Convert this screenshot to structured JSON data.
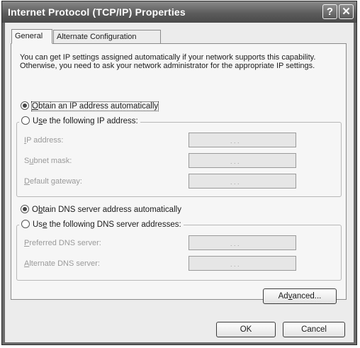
{
  "window": {
    "title": "Internet Protocol (TCP/IP) Properties",
    "help_glyph": "?",
    "close_glyph": "✕"
  },
  "tabs": [
    {
      "label": "General"
    },
    {
      "label": "Alternate Configuration"
    }
  ],
  "general": {
    "description": "You can get IP settings assigned automatically if your network supports this capability. Otherwise, you need to ask your network administrator for the appropriate IP settings.",
    "ip_auto": {
      "pre": "",
      "key": "O",
      "post": "btain an IP address automatically",
      "selected": true
    },
    "ip_manual": {
      "pre": "U",
      "key": "s",
      "post": "e the following IP address:",
      "selected": false
    },
    "ip_fields": [
      {
        "pre": "",
        "key": "I",
        "post": "P address:",
        "value": ".   .   ."
      },
      {
        "pre": "S",
        "key": "u",
        "post": "bnet mask:",
        "value": ".   .   ."
      },
      {
        "pre": "",
        "key": "D",
        "post": "efault gateway:",
        "value": ".   .   ."
      }
    ],
    "dns_auto": {
      "pre": "O",
      "key": "b",
      "post": "tain DNS server address automatically",
      "selected": true
    },
    "dns_manual": {
      "pre": "Us",
      "key": "e",
      "post": " the following DNS server addresses:",
      "selected": false
    },
    "dns_fields": [
      {
        "pre": "",
        "key": "P",
        "post": "referred DNS server:",
        "value": ".   .   ."
      },
      {
        "pre": "",
        "key": "A",
        "post": "lternate DNS server:",
        "value": ".   .   ."
      }
    ],
    "advanced": {
      "pre": "Ad",
      "key": "v",
      "post": "anced..."
    }
  },
  "buttons": {
    "ok": "OK",
    "cancel": "Cancel"
  },
  "colors": {
    "titlebar": "#5c5c5c",
    "dialog": "#ececec",
    "panel": "#f6f6f6"
  }
}
